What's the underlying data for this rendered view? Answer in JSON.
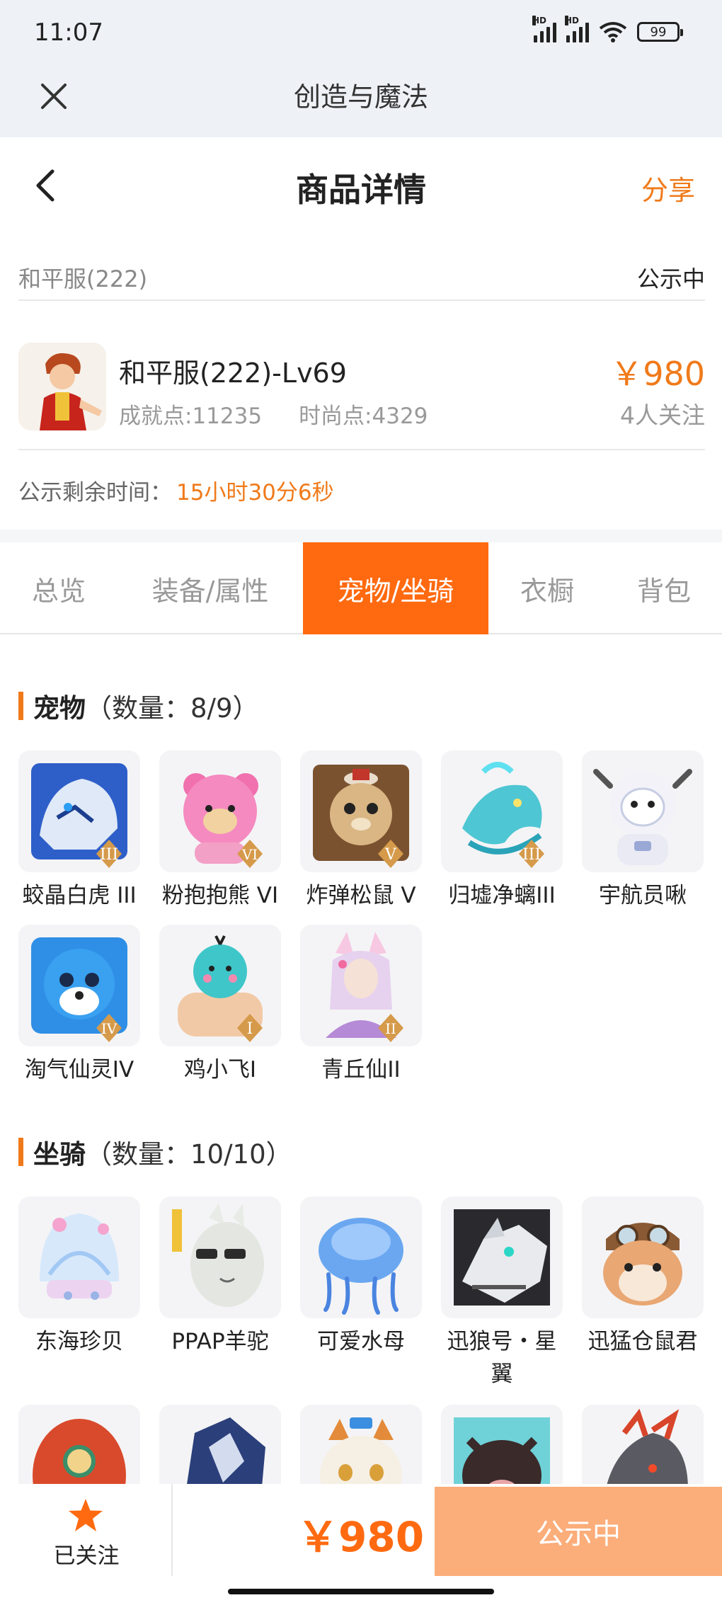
{
  "status_bar": {
    "time": "11:07",
    "battery": "99",
    "signal_label": "HD"
  },
  "app_bar": {
    "title": "创造与魔法"
  },
  "page_header": {
    "title": "商品详情",
    "share": "分享"
  },
  "server": {
    "name": "和平服(222)",
    "status": "公示中"
  },
  "item": {
    "name": "和平服(222)-Lv69",
    "achievement": "成就点:11235",
    "fashion": "时尚点:4329",
    "price": "￥980",
    "followers": "4人关注"
  },
  "remaining": {
    "label": "公示剩余时间：",
    "time": "15小时30分6秒"
  },
  "tabs": [
    {
      "label": "总览"
    },
    {
      "label": "装备/属性"
    },
    {
      "label": "宠物/坐骑"
    },
    {
      "label": "衣橱"
    },
    {
      "label": "背包"
    }
  ],
  "active_tab": "宠物/坐骑",
  "pets_section": {
    "title": "宠物",
    "count": "（数量：8/9）"
  },
  "pets": [
    {
      "name": "蛟晶白虎 III",
      "badge": "III"
    },
    {
      "name": "粉抱抱熊 VI",
      "badge": "VI"
    },
    {
      "name": "炸弹松鼠 V",
      "badge": "V"
    },
    {
      "name": "归墟净螭III",
      "badge": "III"
    },
    {
      "name": "宇航员啾",
      "badge": ""
    },
    {
      "name": "淘气仙灵IV",
      "badge": "IV"
    },
    {
      "name": "鸡小飞I",
      "badge": "I"
    },
    {
      "name": "青丘仙II",
      "badge": "II"
    }
  ],
  "mounts_section": {
    "title": "坐骑",
    "count": "（数量：10/10）"
  },
  "mounts": [
    {
      "name": "东海珍贝"
    },
    {
      "name": "PPAP羊驼"
    },
    {
      "name": "可爱水母"
    },
    {
      "name": "迅狼号・星翼"
    },
    {
      "name": "迅猛仓鼠君"
    }
  ],
  "bottom_bar": {
    "follow_label": "已关注",
    "price": "￥980",
    "cta": "公示中"
  },
  "colors": {
    "accent": "#f07a1a",
    "tab_active": "#ff6a10",
    "cta": "#fbad7a"
  }
}
